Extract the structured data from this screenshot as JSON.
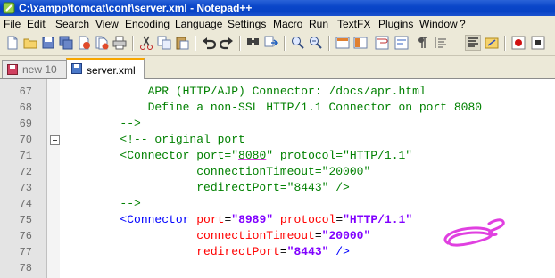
{
  "window": {
    "title": "C:\\xampp\\tomcat\\conf\\server.xml - Notepad++"
  },
  "menu": [
    "File",
    "Edit",
    "Search",
    "View",
    "Encoding",
    "Language",
    "Settings",
    "Macro",
    "Run",
    "TextFX",
    "Plugins",
    "Window",
    "?"
  ],
  "toolbar_icons": [
    "new-icon",
    "open-icon",
    "save-icon",
    "save-all-icon",
    "close-icon",
    "close-all-icon",
    "print-icon",
    "cut-icon",
    "copy-icon",
    "paste-icon",
    "undo-icon",
    "redo-icon",
    "find-icon",
    "replace-icon",
    "zoom-in-icon",
    "zoom-out-icon",
    "sync-v-icon",
    "sync-h-icon",
    "wrap-icon",
    "show-all-chars-icon",
    "indent-guide-icon",
    "doc-map-icon",
    "record-macro-icon",
    "stop-record-icon"
  ],
  "tabs": [
    {
      "label": "new 10",
      "active": false
    },
    {
      "label": "server.xml",
      "active": true
    }
  ],
  "lines": [
    {
      "n": "67",
      "tokens": [
        {
          "t": "            APR (HTTP/AJP) Connector: /docs/apr.html",
          "c": "c-comment"
        }
      ]
    },
    {
      "n": "68",
      "tokens": [
        {
          "t": "            Define a non-SSL HTTP/1.1 Connector on port 8080",
          "c": "c-comment"
        }
      ]
    },
    {
      "n": "69",
      "tokens": [
        {
          "t": "        -->",
          "c": "c-comment"
        }
      ]
    },
    {
      "n": "70",
      "tokens": [
        {
          "t": "        <!-- original port",
          "c": "c-comment"
        }
      ]
    },
    {
      "n": "71",
      "tokens": [
        {
          "t": "        <Connector port=\"",
          "c": "c-comment"
        },
        {
          "t": "8080",
          "c": "c-comment underline"
        },
        {
          "t": "\" protocol=\"HTTP/1.1\"",
          "c": "c-comment"
        }
      ]
    },
    {
      "n": "72",
      "tokens": [
        {
          "t": "                   connectionTimeout=\"20000\"",
          "c": "c-comment"
        }
      ]
    },
    {
      "n": "73",
      "tokens": [
        {
          "t": "                   redirectPort=\"8443\" />",
          "c": "c-comment"
        }
      ]
    },
    {
      "n": "74",
      "tokens": [
        {
          "t": "        -->",
          "c": "c-comment"
        }
      ]
    },
    {
      "n": "75",
      "tokens": [
        {
          "t": "        <Connector ",
          "c": "c-tag"
        },
        {
          "t": "port",
          "c": "c-attr"
        },
        {
          "t": "=",
          "c": "c-plain"
        },
        {
          "t": "\"8989\"",
          "c": "c-val"
        },
        {
          "t": " ",
          "c": "c-plain"
        },
        {
          "t": "protocol",
          "c": "c-attr"
        },
        {
          "t": "=",
          "c": "c-plain"
        },
        {
          "t": "\"HTTP/1.1\"",
          "c": "c-val"
        }
      ]
    },
    {
      "n": "76",
      "tokens": [
        {
          "t": "                   ",
          "c": "c-plain"
        },
        {
          "t": "connectionTimeout",
          "c": "c-attr"
        },
        {
          "t": "=",
          "c": "c-plain"
        },
        {
          "t": "\"20000\"",
          "c": "c-val"
        }
      ]
    },
    {
      "n": "77",
      "tokens": [
        {
          "t": "                   ",
          "c": "c-plain"
        },
        {
          "t": "redirectPort",
          "c": "c-attr"
        },
        {
          "t": "=",
          "c": "c-plain"
        },
        {
          "t": "\"8443\"",
          "c": "c-val"
        },
        {
          "t": " />",
          "c": "c-tag"
        }
      ]
    },
    {
      "n": "78",
      "tokens": []
    }
  ],
  "colors": {
    "comment": "#008000",
    "tag": "#0000ff",
    "attribute": "#ff0000",
    "value": "#8000ff",
    "annotation": "#e040e0",
    "titlebar": "#0a46c9"
  }
}
